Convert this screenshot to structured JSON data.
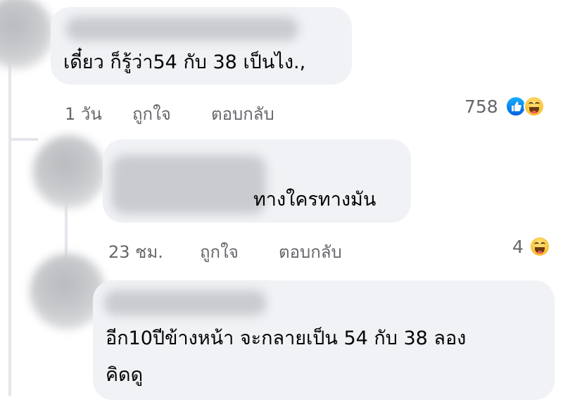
{
  "comments": [
    {
      "text": "เดี๋ยว ก็รู้ว่า54 กับ 38 เป็นไง.,",
      "time": "1 วัน",
      "like": "ถูกใจ",
      "reply": "ตอบกลับ",
      "reaction_count": "758",
      "reactions": [
        "like-icon",
        "haha-icon"
      ]
    },
    {
      "text": "ทางใครทางมัน",
      "time": "23 ชม.",
      "like": "ถูกใจ",
      "reply": "ตอบกลับ",
      "reaction_count": "4",
      "reactions": [
        "haha-icon"
      ]
    },
    {
      "text_line1": "อีก10ปีข้างหน้า จะกลายเป็น 54 กับ 38 ลอง",
      "text_line2": "คิดดู"
    }
  ],
  "colors": {
    "bubble": "#f0f2f5",
    "meta_text": "#65676b",
    "like_blue": "#1877f2",
    "haha_yellow": "#f7c137"
  }
}
